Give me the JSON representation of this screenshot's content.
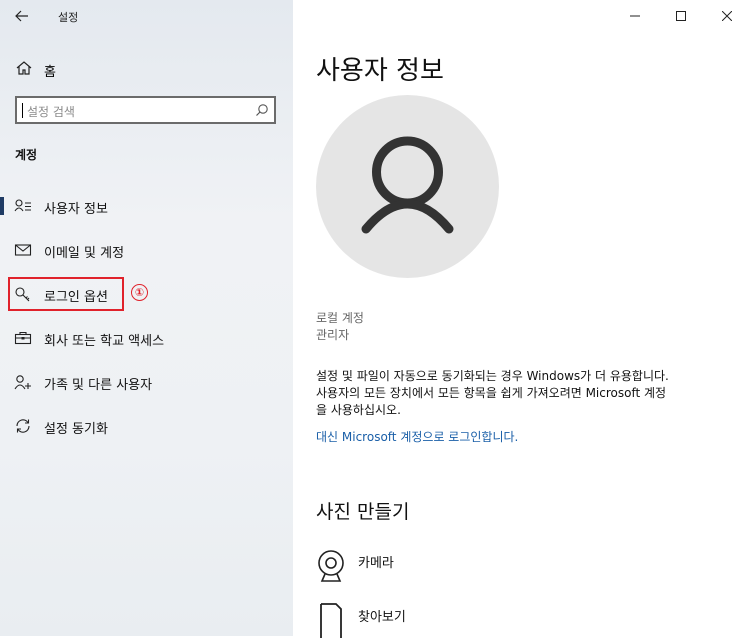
{
  "window": {
    "title": "설정"
  },
  "sidebar": {
    "home_label": "홈",
    "search_placeholder": "설정 검색",
    "section_title": "계정",
    "items": [
      {
        "label": "사용자 정보",
        "icon": "user-info-icon",
        "selected": true
      },
      {
        "label": "이메일 및 계정",
        "icon": "mail-icon"
      },
      {
        "label": "로그인 옵션",
        "icon": "key-icon"
      },
      {
        "label": "회사 또는 학교 액세스",
        "icon": "briefcase-icon"
      },
      {
        "label": "가족 및 다른 사용자",
        "icon": "person-add-icon"
      },
      {
        "label": "설정 동기화",
        "icon": "sync-icon"
      }
    ],
    "annotation_number": "①",
    "annotation_color": "#e0222b"
  },
  "main": {
    "page_title": "사용자 정보",
    "account_type": "로컬 계정",
    "account_role": "관리자",
    "description_line1": "설정 및 파일이 자동으로 동기화되는 경우 Windows가 더 유용합니다.",
    "description_line2": "사용자의 모든 장치에서 모든 항목을 쉽게 가져오려면 Microsoft 계정",
    "description_line3": "을 사용하십시오.",
    "ms_signin_link": "대신 Microsoft 계정으로 로그인합니다.",
    "create_photo_title": "사진 만들기",
    "photo_options": [
      {
        "label": "카메라",
        "icon": "webcam-icon"
      },
      {
        "label": "찾아보기",
        "icon": "browse-icon"
      }
    ]
  },
  "colors": {
    "accent": "#1a5fa8",
    "selected_bar": "#1f3b64",
    "sidebar_bg": "#eef1f4"
  }
}
